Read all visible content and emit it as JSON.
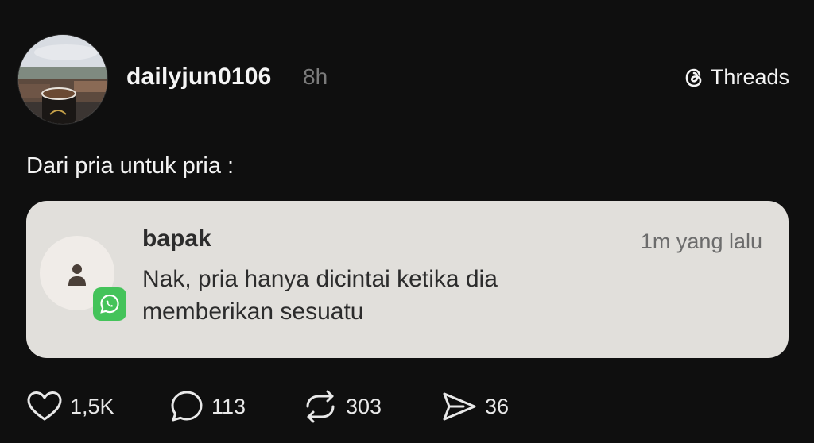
{
  "post": {
    "username": "dailyjun0106",
    "time": "8h",
    "brand": "Threads",
    "caption": "Dari pria untuk pria :"
  },
  "notification": {
    "sender": "bapak",
    "time": "1m yang lalu",
    "message_line1": "Nak, pria hanya dicintai ketika dia",
    "message_line2": "memberikan sesuatu",
    "app_icon": "whatsapp-icon",
    "avatar_icon": "person-icon"
  },
  "actions": {
    "likes": "1,5K",
    "replies": "113",
    "reposts": "303",
    "shares": "36"
  },
  "colors": {
    "background": "#0f0f0f",
    "card": "#e1dfdb",
    "whatsapp": "#44c35a",
    "muted": "#7b7b7b"
  }
}
